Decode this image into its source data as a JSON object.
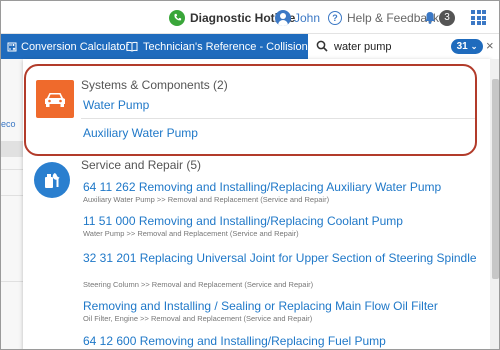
{
  "topbar": {
    "hotline_label": "Diagnostic Hotline",
    "user_label": "John",
    "help_label": "Help & Feedback",
    "help_glyph": "?",
    "notification_count": "3"
  },
  "navbar": {
    "conversion_label": "Conversion Calculator",
    "technician_label": "Technician's Reference - Collision"
  },
  "search": {
    "value": "water pump",
    "count": "31",
    "close_glyph": "×",
    "chevron_glyph": "⌄"
  },
  "left_fragment": "eco",
  "sections": {
    "systems": {
      "title": "Systems & Components (2)",
      "items": [
        {
          "label": "Water Pump"
        },
        {
          "label": "Auxiliary Water Pump"
        }
      ]
    },
    "service": {
      "title": "Service and Repair (5)",
      "items": [
        {
          "title": "64 11 262 Removing and Installing/Replacing Auxiliary Water Pump",
          "path": "Auxiliary Water Pump >> Removal and Replacement (Service and Repair)"
        },
        {
          "title": "11 51 000 Removing and Installing/Replacing Coolant Pump",
          "path": "Water Pump >> Removal and Replacement (Service and Repair)"
        },
        {
          "title": "32 31 201 Replacing Universal Joint for Upper Section of Steering Spindle",
          "path": "Steering Column >> Removal and Replacement (Service and Repair)"
        },
        {
          "title": "Removing and Installing / Sealing or Replacing Main Flow Oil Filter",
          "path": "Oil Filter, Engine >> Removal and Replacement (Service and Repair)"
        },
        {
          "title": "64 12 600 Removing and Installing/Replacing Fuel Pump"
        }
      ]
    }
  },
  "colors": {
    "nav_blue": "#1f6bbd",
    "link_blue": "#1f78c8",
    "systems_orange": "#ef6a2c",
    "highlight_red": "#b23b2a"
  },
  "icons": [
    "phone-icon",
    "user-icon",
    "help-icon",
    "bell-icon",
    "apps-grid-icon",
    "calculator-icon",
    "book-icon",
    "search-icon",
    "car-icon",
    "wrench-icon"
  ]
}
